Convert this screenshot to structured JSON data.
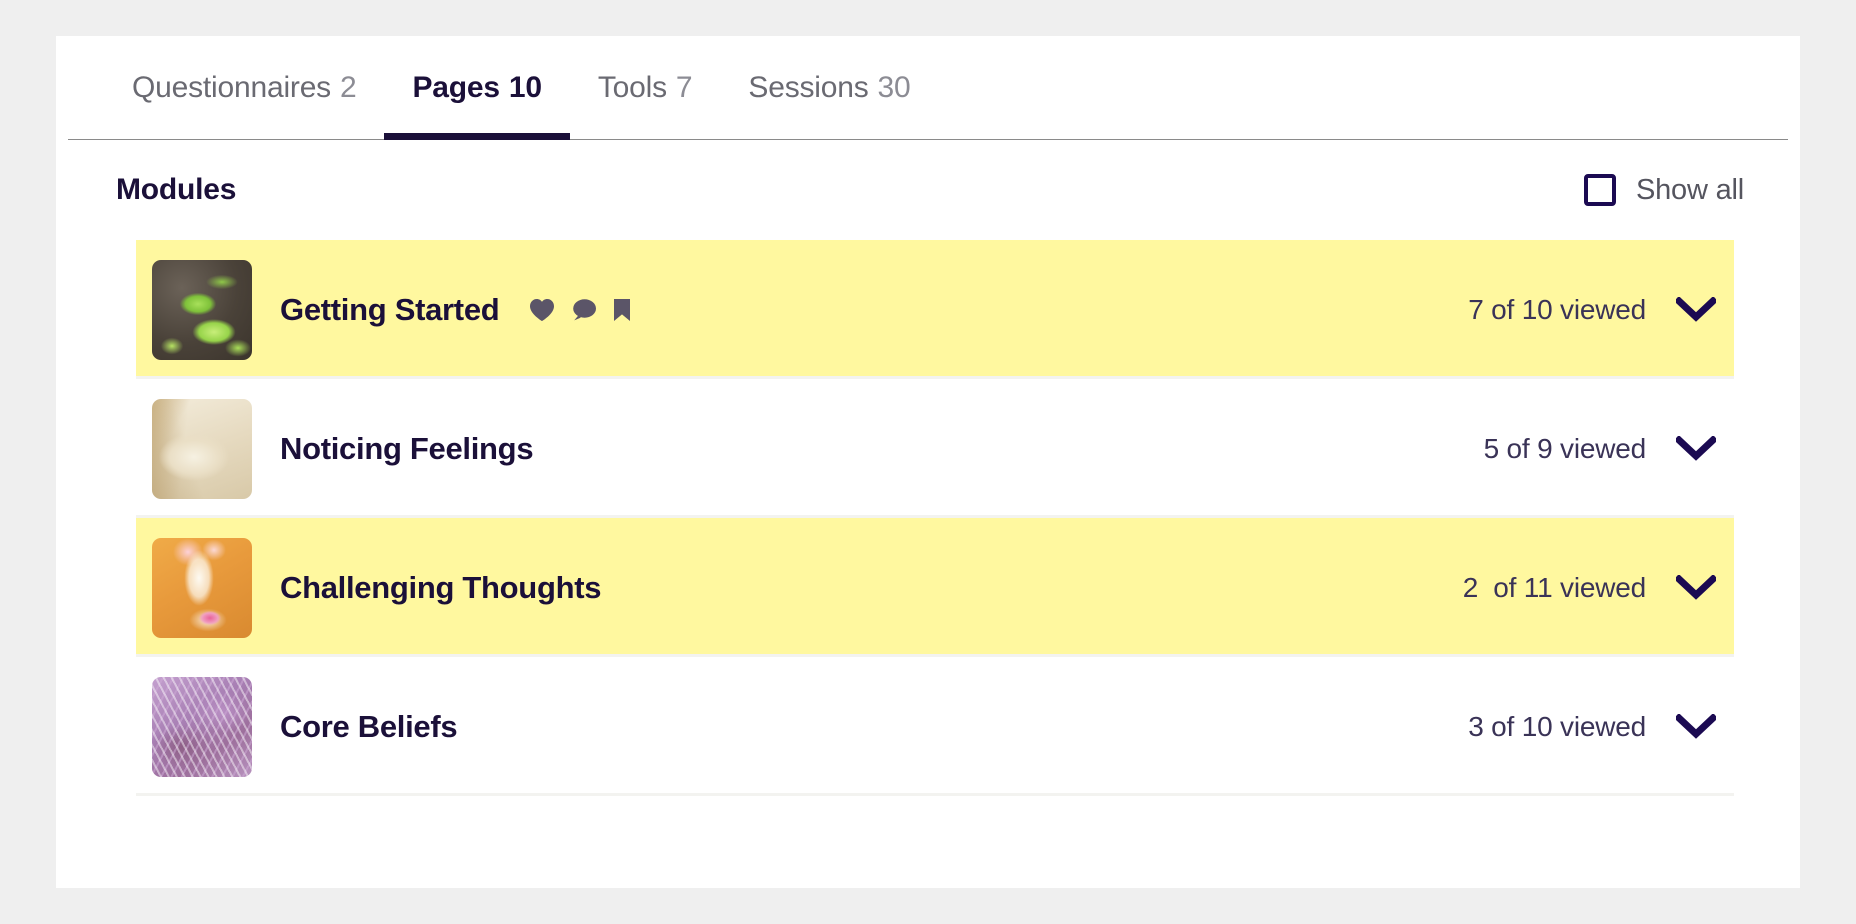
{
  "tabs": [
    {
      "label": "Questionnaires",
      "count": "2",
      "active": false
    },
    {
      "label": "Pages",
      "count": "10",
      "active": true
    },
    {
      "label": "Tools",
      "count": "7",
      "active": false
    },
    {
      "label": "Sessions",
      "count": "30",
      "active": false
    }
  ],
  "section": {
    "title": "Modules",
    "show_all_label": "Show all",
    "show_all_checked": false
  },
  "modules": [
    {
      "name": "Getting Started",
      "viewed": "7 of 10 viewed",
      "highlighted": true,
      "thumb": "seedlings-in-pots",
      "icons": [
        "heart-icon",
        "comment-icon",
        "bookmark-icon"
      ],
      "chevron": "chevron-down-icon"
    },
    {
      "name": "Noticing Feelings",
      "viewed": "5 of 9 viewed",
      "highlighted": false,
      "thumb": "dried-seedhead",
      "icons": [],
      "chevron": "chevron-down-icon"
    },
    {
      "name": "Challenging Thoughts",
      "viewed": "2  of 11 viewed",
      "highlighted": true,
      "thumb": "pink-feather",
      "icons": [],
      "chevron": "chevron-down-icon"
    },
    {
      "name": "Core Beliefs",
      "viewed": "3 of 10 viewed",
      "highlighted": false,
      "thumb": "purple-thistle",
      "icons": [],
      "chevron": "chevron-down-icon"
    }
  ],
  "colors": {
    "page_background": "#efefef",
    "card_background": "#ffffff",
    "accent_dark": "#1b1039",
    "highlight_row": "#fff89f",
    "checkbox_border": "#1b0a52",
    "tab_inactive_text": "#6a6a72",
    "icon_gray": "#5b5568",
    "chevron_navy": "#1b0a52",
    "divider": "#f3f3f0"
  }
}
